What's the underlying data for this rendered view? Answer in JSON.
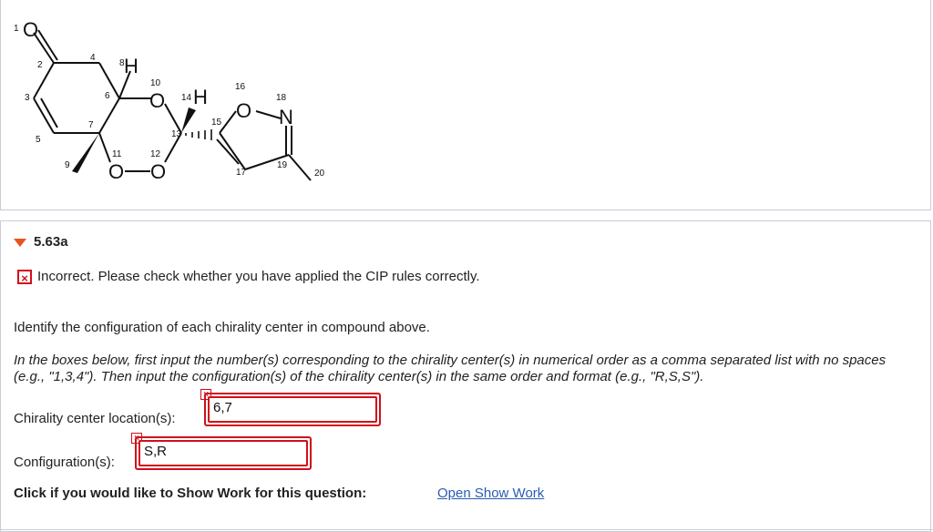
{
  "molecule": {
    "atoms": {
      "o_ketone": "O",
      "h8": "H",
      "o10": "O",
      "h14": "H",
      "o16": "O",
      "n18": "N",
      "o11": "O",
      "o12": "O"
    },
    "numbers": {
      "n1": "1",
      "n2": "2",
      "n3": "3",
      "n4": "4",
      "n5": "5",
      "n6": "6",
      "n7": "7",
      "n8": "8",
      "n9": "9",
      "n10": "10",
      "n11": "11",
      "n12": "12",
      "n13": "13",
      "n14": "14",
      "n15": "15",
      "n16": "16",
      "n17": "17",
      "n18": "18",
      "n19": "19",
      "n20": "20"
    }
  },
  "question": {
    "number": "5.63a",
    "feedback": "Incorrect. Please check whether you have applied the CIP rules correctly.",
    "instruction": "Identify the configuration of each chirality center in compound above.",
    "instruction_detail": "In the boxes below, first input the number(s) corresponding to the chirality center(s) in numerical order as a comma separated list with no spaces (e.g., \"1,3,4\"). Then input the configuration(s) of the chirality center(s) in the same order and format (e.g., \"R,S,S\").",
    "location_label": "Chirality center location(s):",
    "location_value": "6,7",
    "config_label": "Configuration(s):",
    "config_value": "S,R",
    "show_work_text": "Click if you would like to Show Work for this question:",
    "open_show_work": "Open Show Work"
  },
  "colors": {
    "error_red": "#d0101b",
    "accent_orange": "#e8531f",
    "link_blue": "#2a5db0"
  }
}
